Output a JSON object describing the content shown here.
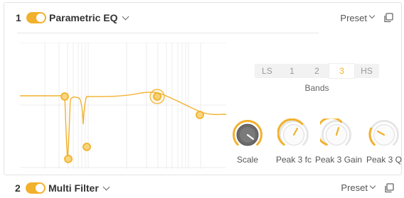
{
  "modules": [
    {
      "index": "1",
      "title": "Parametric EQ",
      "enabled": true,
      "preset_label": "Preset",
      "bands": {
        "options": [
          "LS",
          "1",
          "2",
          "3",
          "HS"
        ],
        "selected": "3",
        "label": "Bands"
      },
      "knobs": [
        {
          "label": "Scale",
          "value": 0.3,
          "style": "dark"
        },
        {
          "label": "Peak 3 fc",
          "value": 0.6,
          "style": "light"
        },
        {
          "label": "Peak 3 Gain",
          "value": 0.55,
          "style": "light"
        },
        {
          "label": "Peak 3 Q",
          "value": 0.3,
          "style": "light"
        }
      ]
    },
    {
      "index": "2",
      "title": "Multi Filter",
      "enabled": true,
      "preset_label": "Preset"
    }
  ],
  "colors": {
    "accent": "#f2b12c",
    "knob_track": "#e6e6e6",
    "grid": "#eeeeee"
  },
  "icons": {
    "expand": "chevron-down-icon",
    "copy": "copy-icon"
  }
}
